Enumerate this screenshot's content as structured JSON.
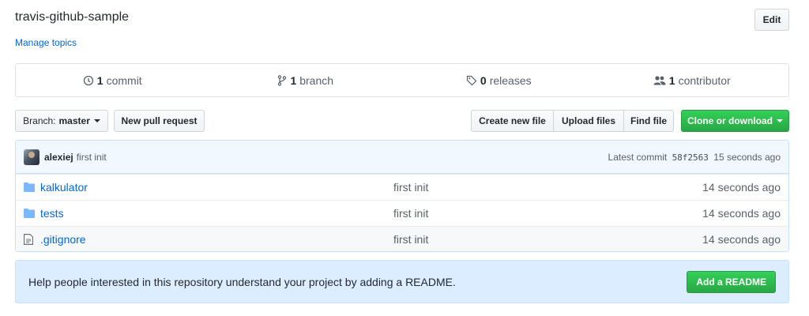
{
  "repo": {
    "title": "travis-github-sample",
    "manage_topics": "Manage topics",
    "edit_label": "Edit"
  },
  "summary": {
    "commits_count": "1",
    "commits_label": "commit",
    "branches_count": "1",
    "branches_label": "branch",
    "releases_count": "0",
    "releases_label": "releases",
    "contributors_count": "1",
    "contributors_label": "contributor"
  },
  "toolbar": {
    "branch_prefix": "Branch:",
    "branch_name": "master",
    "new_pr": "New pull request",
    "create_file": "Create new file",
    "upload_files": "Upload files",
    "find_file": "Find file",
    "clone": "Clone or download"
  },
  "latest_commit": {
    "author": "alexiej",
    "message": "first init",
    "prefix": "Latest commit",
    "sha": "58f2563",
    "age": "15 seconds ago"
  },
  "files": [
    {
      "name": "kalkulator",
      "type": "directory",
      "message": "first init",
      "age": "14 seconds ago"
    },
    {
      "name": "tests",
      "type": "directory",
      "message": "first init",
      "age": "14 seconds ago"
    },
    {
      "name": ".gitignore",
      "type": "file",
      "message": "first init",
      "age": "14 seconds ago"
    }
  ],
  "readme": {
    "text": "Help people interested in this repository understand your project by adding a README.",
    "button": "Add a README"
  },
  "colors": {
    "link": "#0366d6",
    "primary_green": "#28a745",
    "banner_blue": "#dbedff"
  },
  "icons": [
    "commit-icon",
    "branch-icon",
    "tag-icon",
    "people-icon",
    "folder-icon",
    "file-icon"
  ]
}
